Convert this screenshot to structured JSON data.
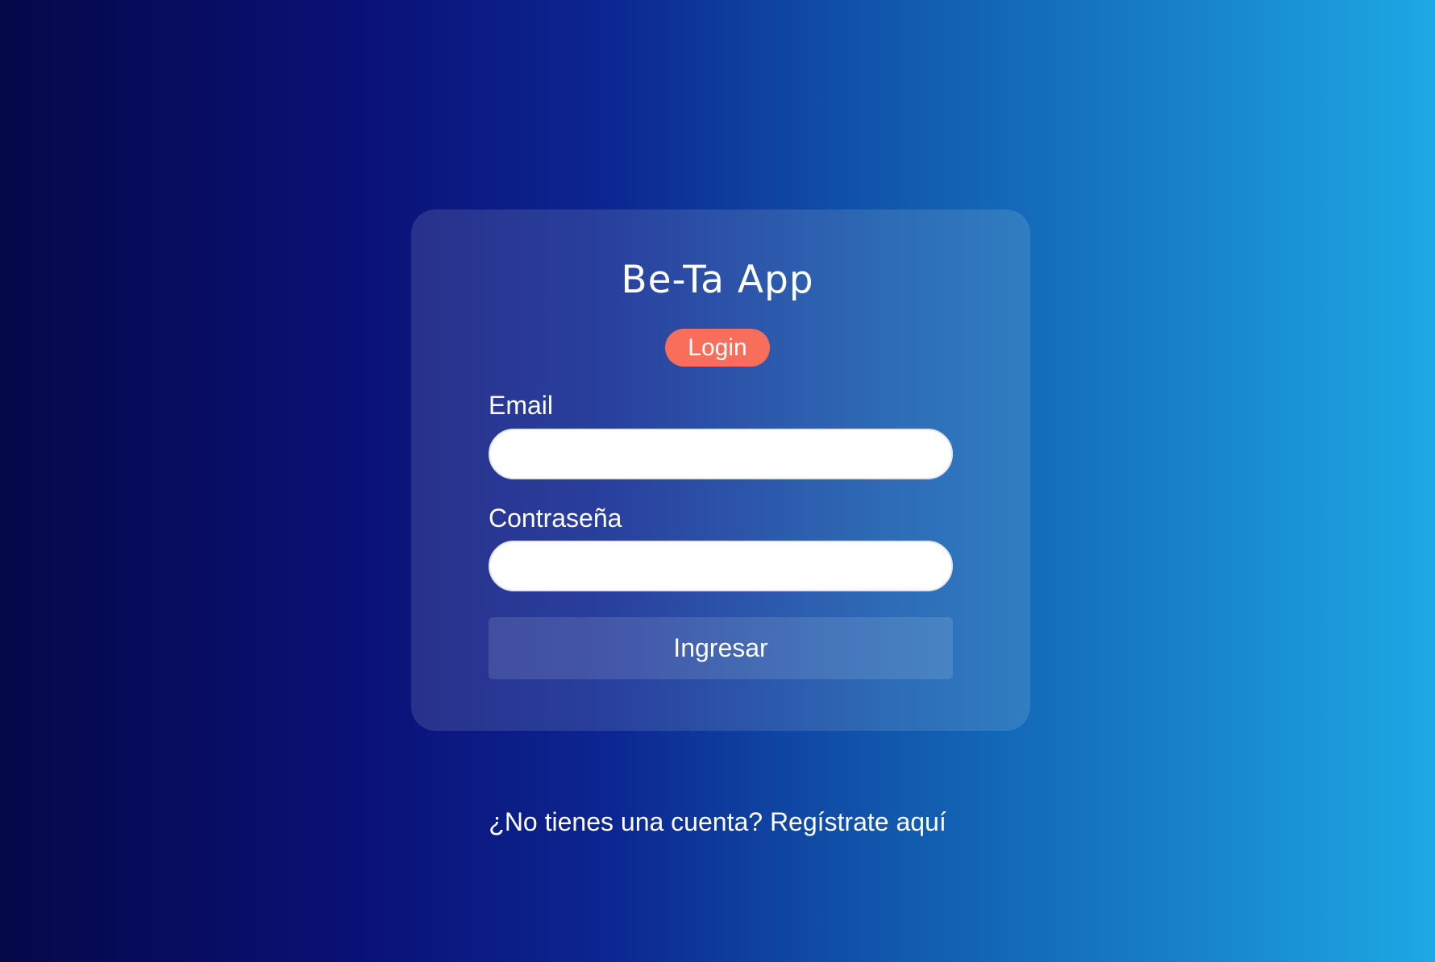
{
  "app": {
    "title": "Be-Ta App",
    "mode_badge": "Login"
  },
  "form": {
    "email_label": "Email",
    "email_value": "",
    "password_label": "Contraseña",
    "password_value": "",
    "submit_label": "Ingresar"
  },
  "footer": {
    "prompt_text": "¿No tienes una cuenta?",
    "register_link": "Regístrate aquí"
  },
  "colors": {
    "badge": "#f96d5b",
    "gradient_start": "#050848",
    "gradient_end": "#1da8e4"
  }
}
